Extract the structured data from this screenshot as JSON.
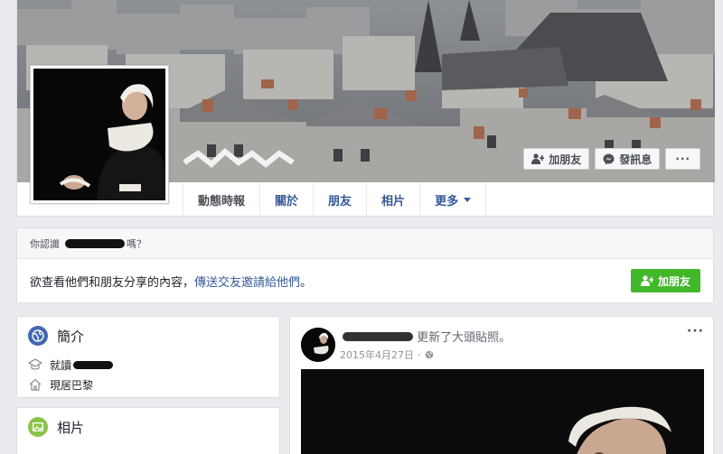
{
  "cover": {
    "buttons": {
      "add_friend": "加朋友",
      "message": "發訊息",
      "more": "···"
    }
  },
  "tabs": [
    {
      "label": "動態時報",
      "active": true
    },
    {
      "label": "關於"
    },
    {
      "label": "朋友"
    },
    {
      "label": "相片"
    },
    {
      "label": "更多"
    }
  ],
  "know": {
    "prefix": "你認識",
    "suffix": "嗎？",
    "body_text": "欲查看他們和朋友分享的內容，",
    "body_link": "傳送交友邀請給他們",
    "body_end": "。",
    "button": "加朋友"
  },
  "intro": {
    "title": "簡介",
    "study_prefix": "就讀",
    "lives": "現居巴黎"
  },
  "photos": {
    "title": "相片"
  },
  "post": {
    "action": "更新了大頭貼照。",
    "date": "2015年4月27日",
    "separator": "·",
    "more": "···"
  },
  "colors": {
    "link": "#365899",
    "green": "#42b72a",
    "background": "#e9ebee"
  }
}
